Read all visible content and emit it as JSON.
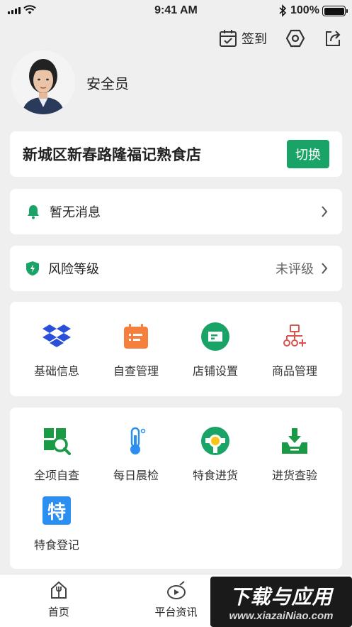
{
  "status_bar": {
    "time": "9:41 AM",
    "battery_percent": "100%",
    "battery_level": 1.0
  },
  "header": {
    "checkin_label": "签到",
    "icons": [
      "calendar-check-icon",
      "settings-hex-icon",
      "share-icon"
    ]
  },
  "profile": {
    "role": "安全员"
  },
  "store": {
    "name": "新城区新春路隆福记熟食店",
    "switch_label": "切换"
  },
  "messages": {
    "label": "暂无消息",
    "icon": "bell-icon"
  },
  "risk": {
    "label": "风险等级",
    "value": "未评级",
    "icon": "shield-icon"
  },
  "menu_primary": {
    "items": [
      {
        "label": "基础信息",
        "icon": "dropbox-cubes-icon"
      },
      {
        "label": "自查管理",
        "icon": "calendar-list-icon"
      },
      {
        "label": "店铺设置",
        "icon": "store-ticket-icon"
      },
      {
        "label": "商品管理",
        "icon": "org-tree-icon"
      }
    ]
  },
  "menu_secondary": {
    "items": [
      {
        "label": "全项自查",
        "icon": "magnify-grid-icon"
      },
      {
        "label": "每日晨检",
        "icon": "thermometer-icon"
      },
      {
        "label": "特食进货",
        "icon": "special-food-icon"
      },
      {
        "label": "进货查验",
        "icon": "download-tray-icon"
      },
      {
        "label": "特食登记",
        "icon": "te-badge-icon",
        "badge_text": "特"
      }
    ]
  },
  "tabs": [
    {
      "label": "首页",
      "icon": "home-icon"
    },
    {
      "label": "平台资讯",
      "icon": "news-play-icon"
    },
    {
      "label": "",
      "icon": "user-icon"
    }
  ],
  "watermark": {
    "title": "下载与应用",
    "url": "www.xiazaiNiao.com"
  },
  "colors": {
    "accent": "#1aa367",
    "orange": "#f5803e",
    "red": "#d9534f",
    "blue": "#2a8ff0",
    "background": "#efefef"
  }
}
